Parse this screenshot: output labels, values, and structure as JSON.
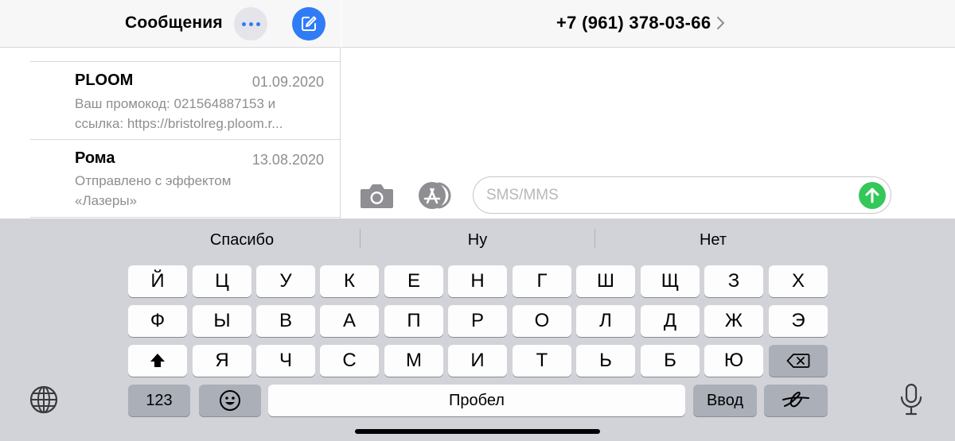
{
  "sidebar": {
    "title": "Сообщения",
    "conversations": [
      {
        "name": "PLOOM",
        "date": "01.09.2020",
        "preview_line1": "Ваш промокод: 021564887153 и",
        "preview_line2": "ссылка: https://bristolreg.ploom.r..."
      },
      {
        "name": "Рома",
        "date": "13.08.2020",
        "preview_line1": "Отправлено с эффектом",
        "preview_line2": "«Лазеры»"
      }
    ]
  },
  "chat": {
    "contact": "+7 (961) 378-03-66",
    "input_placeholder": "SMS/MMS",
    "input_value": ""
  },
  "keyboard": {
    "suggestions": [
      "Спасибо",
      "Ну",
      "Нет"
    ],
    "row1": [
      "Й",
      "Ц",
      "У",
      "К",
      "Е",
      "Н",
      "Г",
      "Ш",
      "Щ",
      "З",
      "Х"
    ],
    "row2": [
      "Ф",
      "Ы",
      "В",
      "А",
      "П",
      "Р",
      "О",
      "Л",
      "Д",
      "Ж",
      "Э"
    ],
    "row3": [
      "Я",
      "Ч",
      "С",
      "М",
      "И",
      "Т",
      "Ь",
      "Б",
      "Ю"
    ],
    "numbers_label": "123",
    "space_label": "Пробел",
    "return_label": "Ввод"
  },
  "colors": {
    "accent": "#2f7cf6",
    "send": "#34c759",
    "keyboard_bg": "#d1d3d9"
  }
}
